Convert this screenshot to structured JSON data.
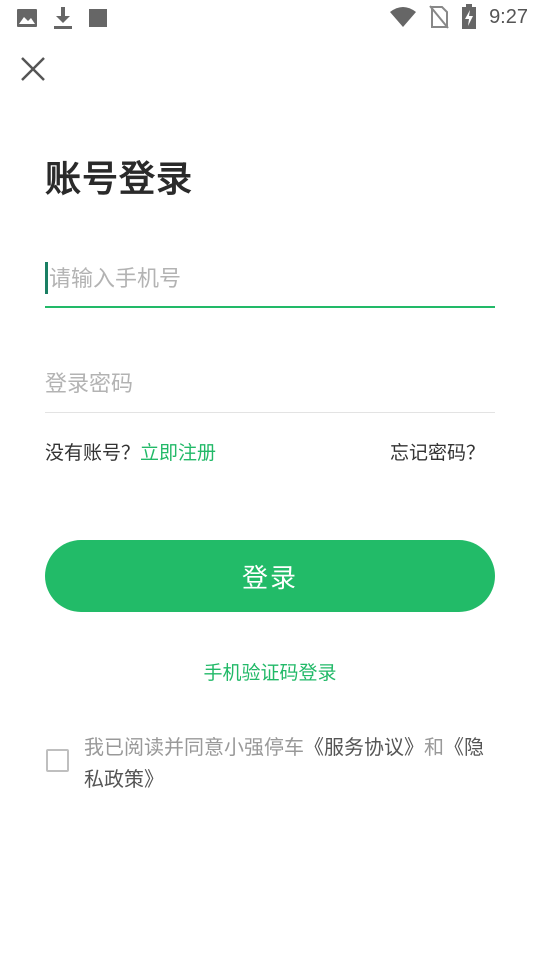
{
  "status_bar": {
    "time": "9:27",
    "left_icons": [
      "image-icon",
      "download-icon",
      "square-icon"
    ],
    "right_icons": [
      "wifi-icon",
      "no-sim-icon",
      "battery-charging-icon"
    ]
  },
  "nav": {
    "close_icon": "close-icon"
  },
  "title": "账号登录",
  "phone": {
    "placeholder": "请输入手机号",
    "value": ""
  },
  "password": {
    "placeholder": "登录密码",
    "value": ""
  },
  "links": {
    "no_account": "没有账号？",
    "register": "立即注册",
    "forgot": "忘记密码？"
  },
  "login_button": "登录",
  "sms_login": "手机验证码登录",
  "agreement": {
    "checked": false,
    "prefix": "我已阅读并同意小强停车",
    "service": "《服务协议》",
    "and": "和",
    "privacy": "《隐私政策》"
  },
  "colors": {
    "accent": "#22bb68",
    "caret": "#1a7f63",
    "placeholder": "#b3b3b3"
  }
}
